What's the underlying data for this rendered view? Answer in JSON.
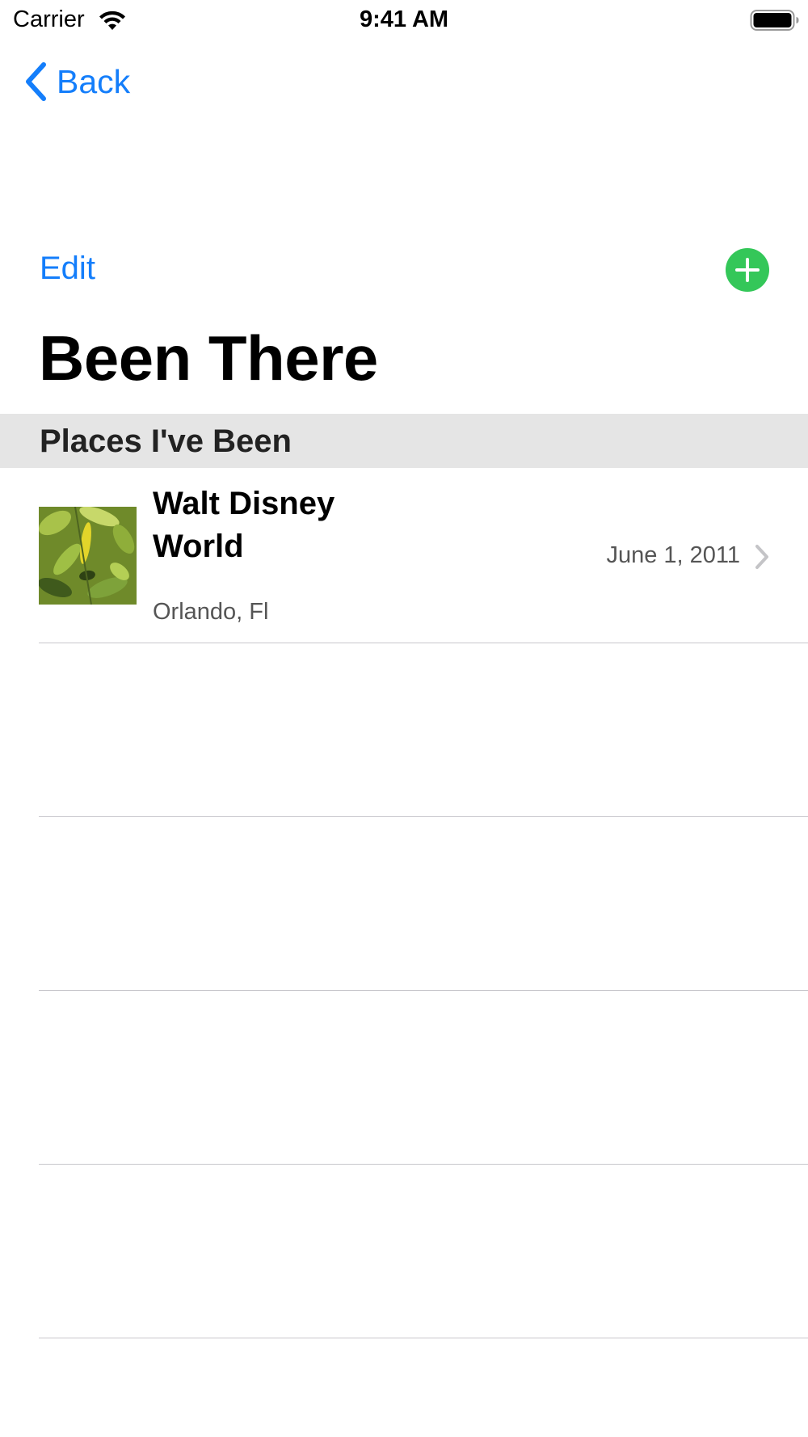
{
  "status_bar": {
    "carrier": "Carrier",
    "time": "9:41 AM",
    "icons": [
      "wifi-icon",
      "battery-icon"
    ]
  },
  "nav": {
    "back_label": "Back",
    "back_icon": "chevron-left-icon",
    "edit_label": "Edit",
    "add_icon": "plus-circle-icon"
  },
  "title": "Been There",
  "section": {
    "header": "Places I've Been"
  },
  "places": [
    {
      "name": "Walt Disney World",
      "location": "Orlando, Fl",
      "date": "June 1, 2011",
      "thumbnail": "leaf-photo",
      "accessory": "chevron-right-icon"
    }
  ],
  "colors": {
    "tint": "#147efb",
    "add_button": "#34c759",
    "section_header_bg": "#e5e5e5",
    "separator": "#c8c7cc",
    "secondary_text": "#555555"
  }
}
